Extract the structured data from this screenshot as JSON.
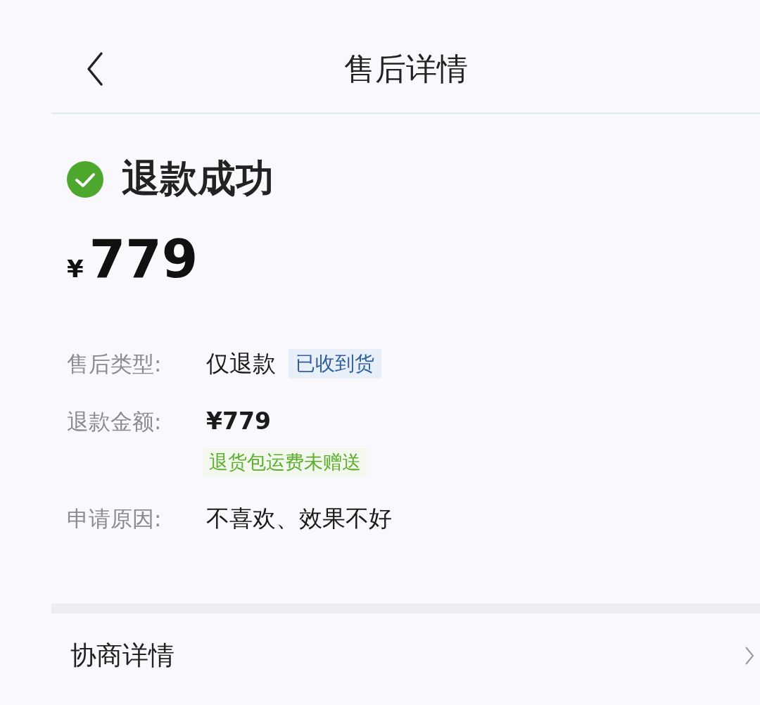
{
  "header": {
    "title": "售后详情"
  },
  "status": {
    "text": "退款成功",
    "currency": "¥",
    "amount": "779"
  },
  "details": [
    {
      "label": "售后类型:",
      "value": "仅退款",
      "tag": {
        "text": "已收到货",
        "color": "#2f5f9e"
      }
    },
    {
      "label": "退款金额:",
      "value": "¥779",
      "note": {
        "text": "退货包运费未赠送",
        "color": "#5cae2c"
      }
    },
    {
      "label": "申请原因:",
      "value": "不喜欢、效果不好"
    }
  ],
  "sections": [
    {
      "title": "协商详情"
    }
  ]
}
